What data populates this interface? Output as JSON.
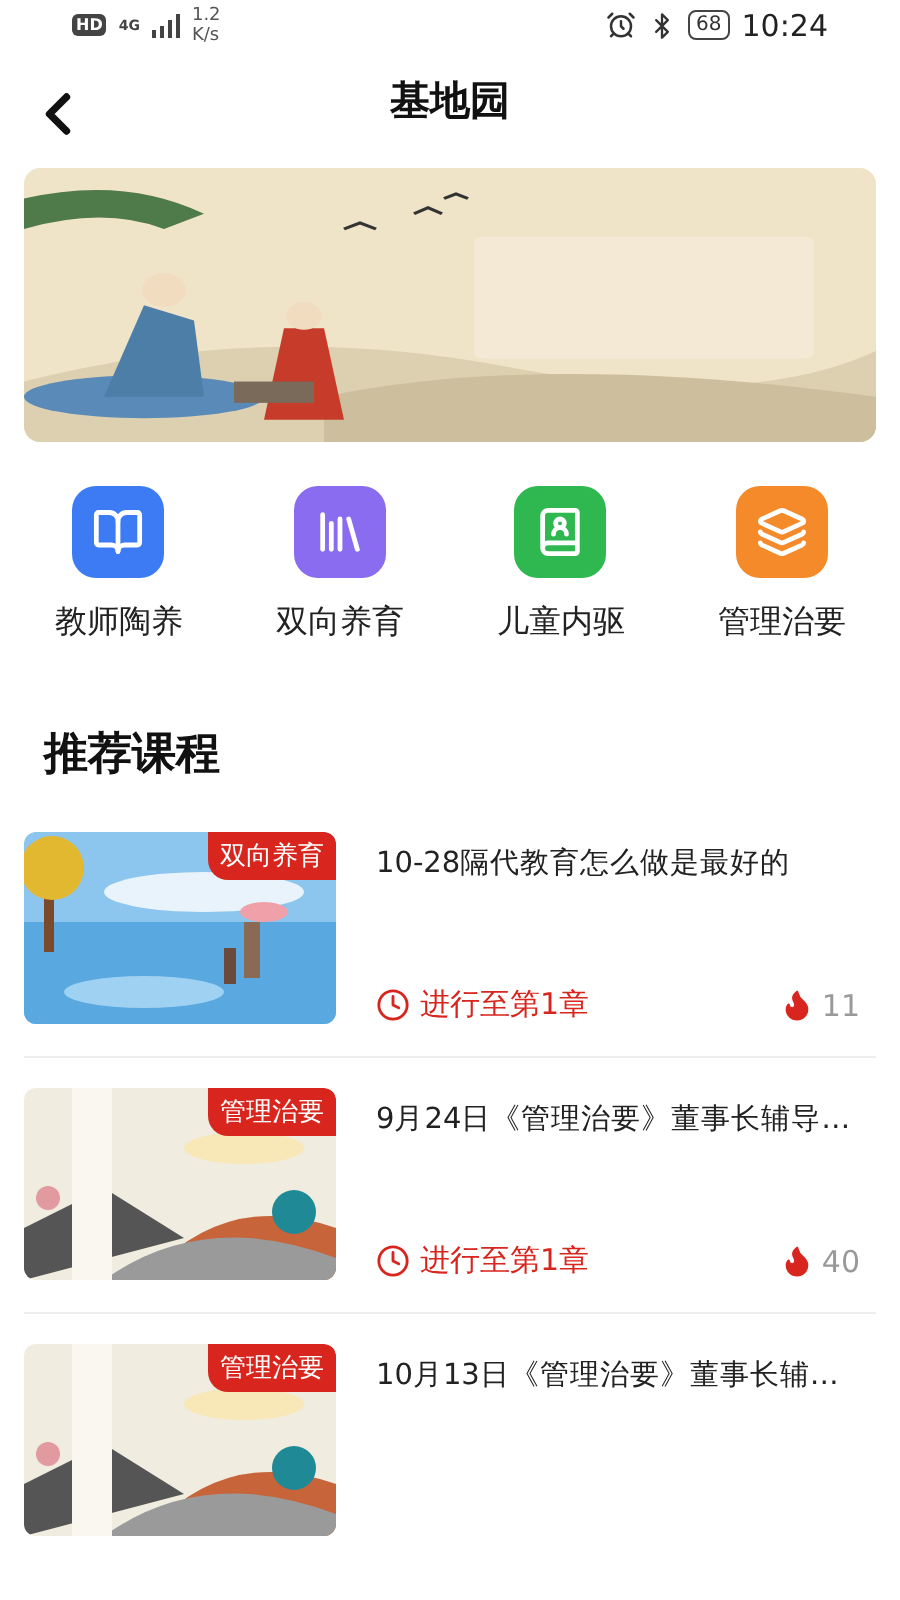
{
  "status_bar": {
    "hd": "HD",
    "network": "4G",
    "speed_value": "1.2",
    "speed_unit": "K/s",
    "battery": "68",
    "time": "10:24"
  },
  "header": {
    "title": "基地园"
  },
  "categories": [
    {
      "label": "教师陶养",
      "color": "#3d7bf5"
    },
    {
      "label": "双向养育",
      "color": "#8a6cf0"
    },
    {
      "label": "儿童内驱",
      "color": "#2fb84f"
    },
    {
      "label": "管理治要",
      "color": "#f58a2a"
    }
  ],
  "section_title": "推荐课程",
  "courses": [
    {
      "tag": "双向养育",
      "title": "10-28隔代教育怎么做是最好的",
      "progress": "进行至第1章",
      "views": "11"
    },
    {
      "tag": "管理治要",
      "title": "9月24日《管理治要》董事长辅导…",
      "progress": "进行至第1章",
      "views": "40"
    },
    {
      "tag": "管理治要",
      "title": "10月13日《管理治要》董事长辅…"
    }
  ]
}
